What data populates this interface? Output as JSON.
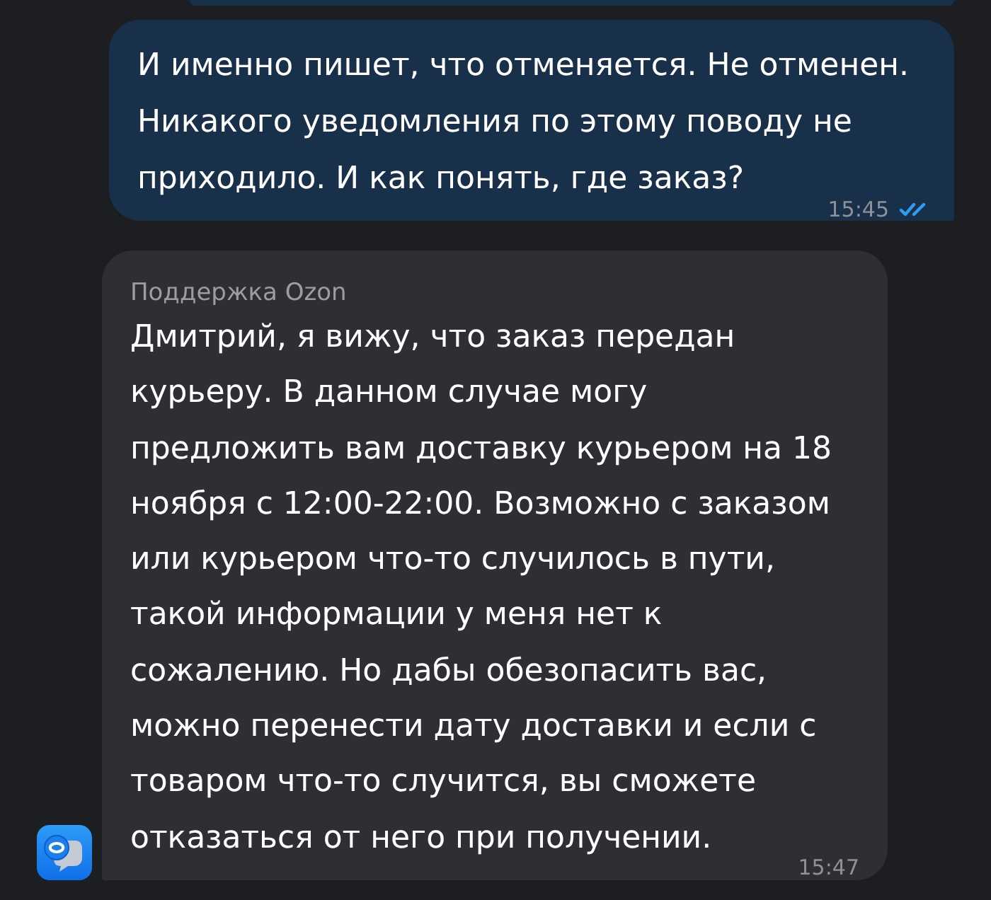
{
  "messages": [
    {
      "kind": "outgoing",
      "text": "И именно пишет, что отменяется. Не отменен. Никакого уведомления по этому поводу не приходило. И как понять, где заказ?",
      "time": "15:45",
      "read": true
    },
    {
      "kind": "incoming",
      "sender": "Поддержка Ozon",
      "text": "Дмитрий, я вижу, что заказ передан курьеру. В данном случае могу предложить вам доставку курьером на 18 ноября с 12:00-22:00. Возможно с заказом или курьером что-то случилось в пути, такой информации у меня нет к сожалению. Но дабы обезопасить вас, можно перенести дату доставки и если с товаром что-то случится, вы сможете отказаться от него при получении.",
      "time": "15:47"
    }
  ]
}
